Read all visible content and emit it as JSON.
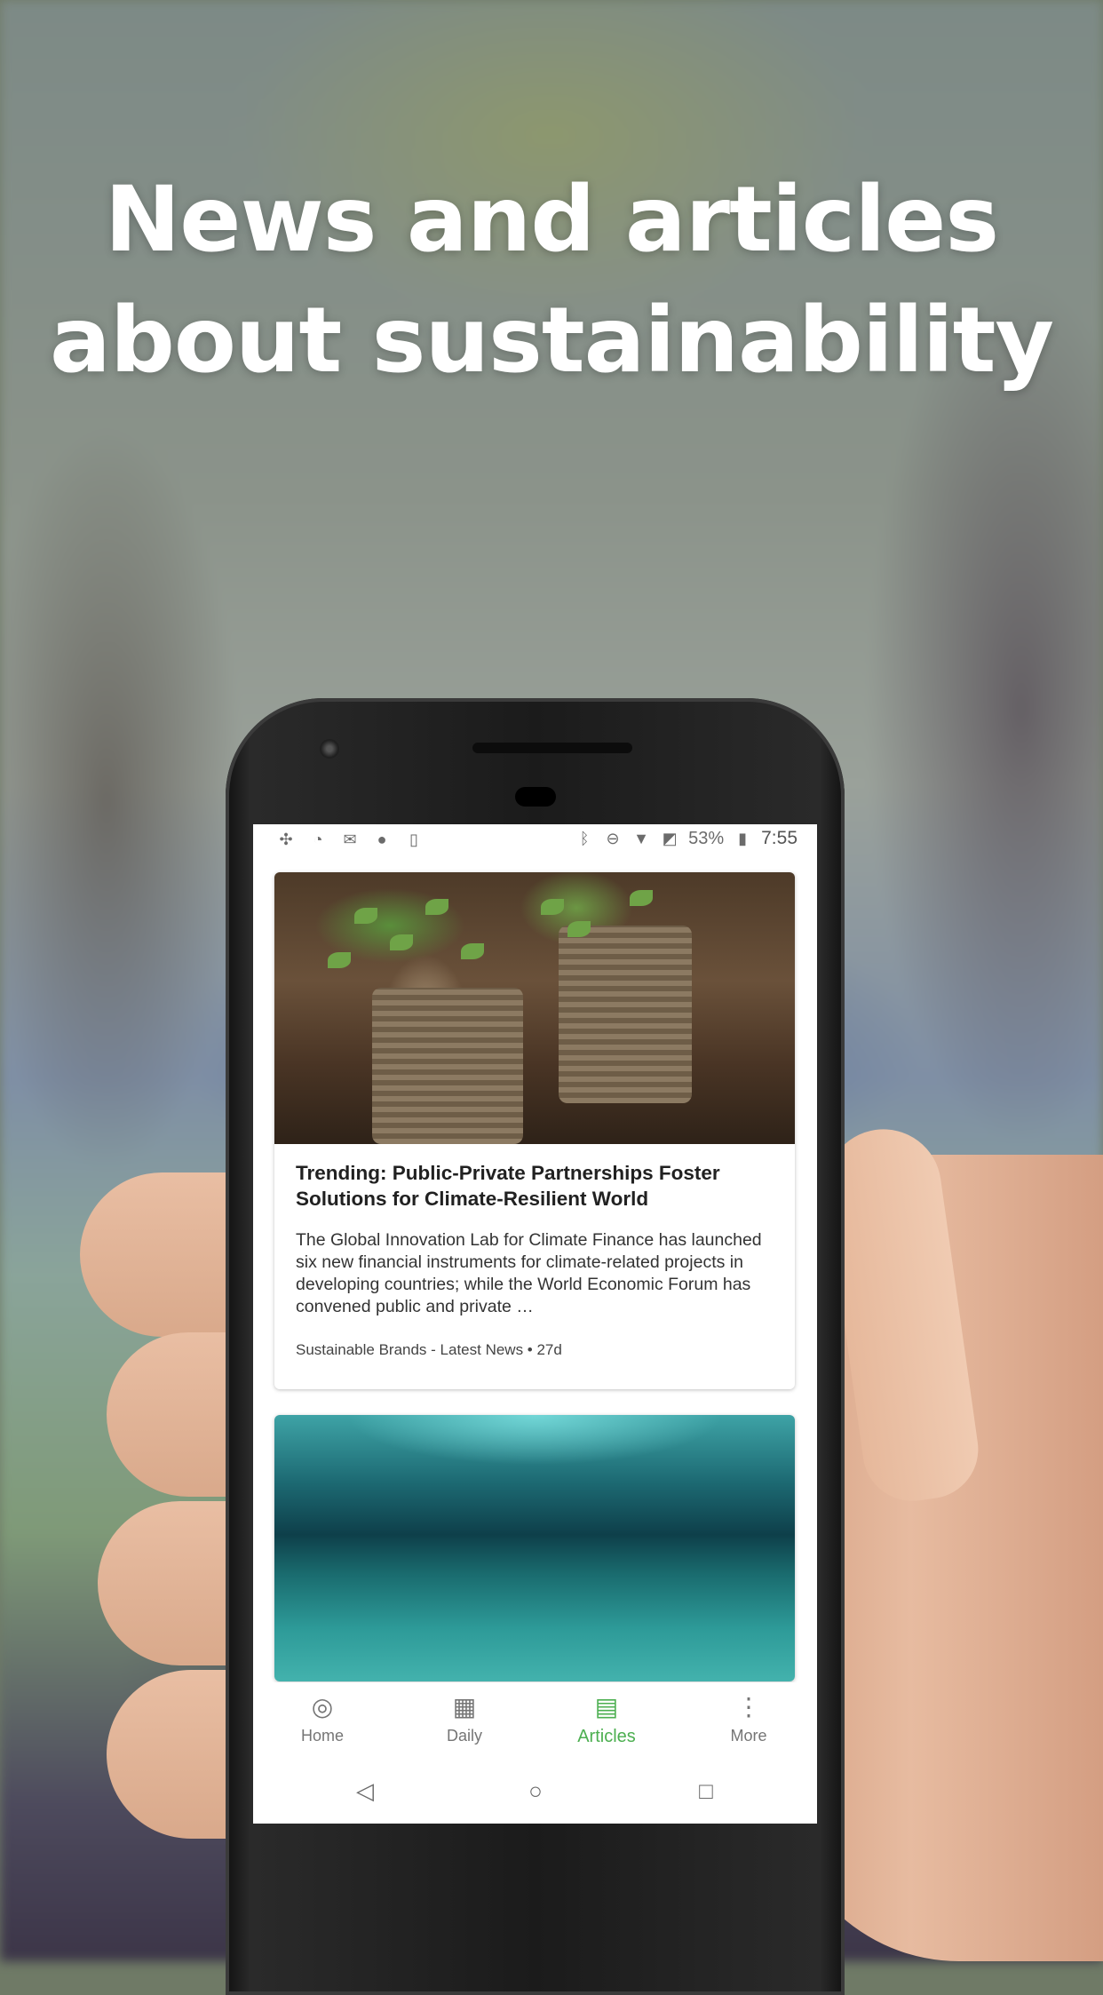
{
  "headline": {
    "line1": "News and articles",
    "line2": "about sustainability"
  },
  "statusbar": {
    "left_icons": [
      "slack-icon",
      "clock-icon",
      "gmail-icon",
      "circle-icon",
      "download-icon"
    ],
    "right_icons": [
      "bluetooth-icon",
      "do-not-disturb-icon",
      "wifi-icon",
      "no-sim-icon"
    ],
    "battery": "53%",
    "time": "7:55"
  },
  "articles": [
    {
      "title": "Trending: Public-Private Partnerships Foster Solutions for Climate-Resilient World",
      "description": "The Global Innovation Lab for Climate Finance has launched six new financial instruments for climate-related projects in developing countries; while the World Economic Forum has convened public and private …",
      "meta": "Sustainable Brands - Latest News • 27d"
    }
  ],
  "bottom_nav": {
    "items": [
      {
        "label": "Home",
        "icon": "radar-icon"
      },
      {
        "label": "Daily",
        "icon": "calendar-icon"
      },
      {
        "label": "Articles",
        "icon": "articles-icon",
        "active": true
      },
      {
        "label": "More",
        "icon": "more-vertical-icon"
      }
    ],
    "active_color": "#4caf50"
  },
  "system_nav": [
    "back-icon",
    "home-icon",
    "recents-icon"
  ]
}
